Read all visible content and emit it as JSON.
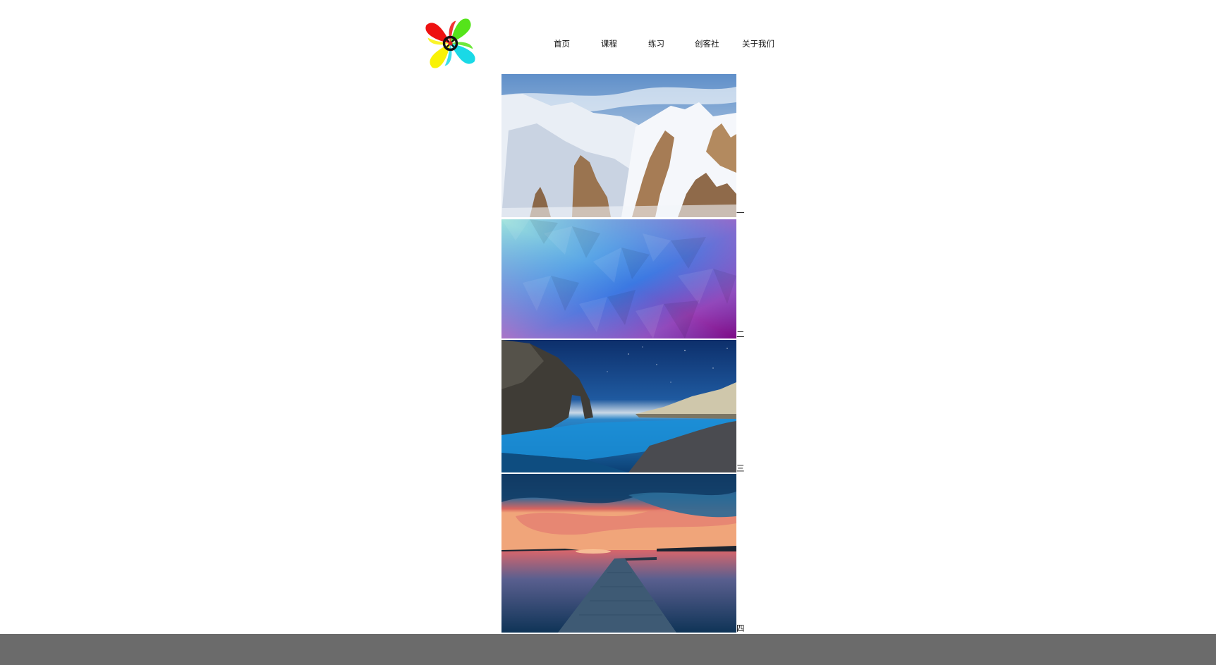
{
  "nav": {
    "items": [
      {
        "label": "首页"
      },
      {
        "label": "课程"
      },
      {
        "label": "练习"
      },
      {
        "label": "创客社"
      },
      {
        "label": "关于我们"
      }
    ]
  },
  "slides": [
    {
      "number": "一",
      "image": "snowy-mountains"
    },
    {
      "number": "二",
      "image": "low-poly-gradient"
    },
    {
      "number": "三",
      "image": "sea-arch-night"
    },
    {
      "number": "四",
      "image": "pier-sunset-lake"
    }
  ],
  "colors": {
    "footer": "#6b6b6b",
    "background": "#ffffff",
    "logo_petals": [
      "#ee1111",
      "#55e41a",
      "#19d9e6",
      "#f9f205"
    ]
  }
}
